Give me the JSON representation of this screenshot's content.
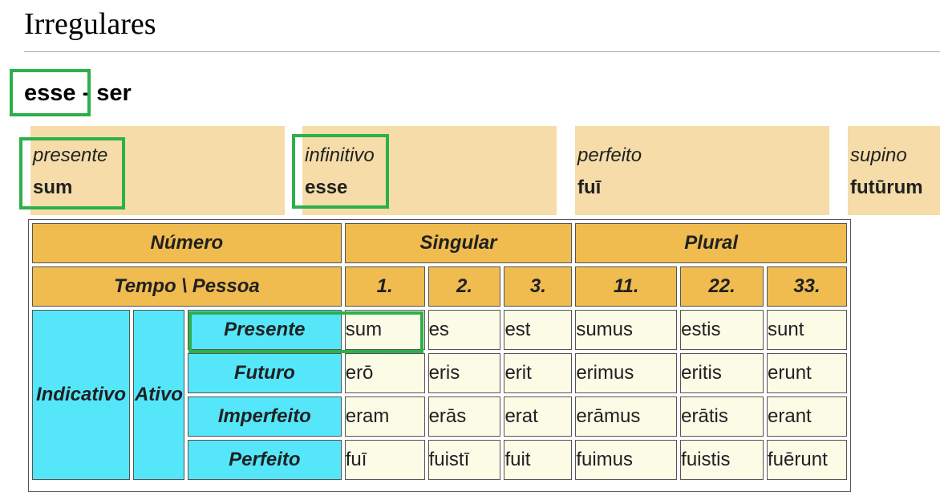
{
  "page": {
    "title": "Irregulares"
  },
  "verb": {
    "infinitive": "esse",
    "separator": " - ",
    "meaning": "ser"
  },
  "principal_parts": [
    {
      "label": "presente",
      "value": "sum"
    },
    {
      "label": "infinitivo",
      "value": "esse"
    },
    {
      "label": "perfeito",
      "value": "fuī"
    },
    {
      "label": "supino",
      "value": "futūrum"
    }
  ],
  "table": {
    "numero_label": "Número",
    "singular_label": "Singular",
    "plural_label": "Plural",
    "tempo_label": "Tempo \\ Pessoa",
    "persons": [
      "1.",
      "2.",
      "3.",
      "11.",
      "22.",
      "33."
    ],
    "mood": "Indicativo",
    "voice": "Ativo",
    "rows": [
      {
        "tense": "Presente",
        "forms": [
          "sum",
          "es",
          "est",
          "sumus",
          "estis",
          "sunt"
        ]
      },
      {
        "tense": "Futuro",
        "forms": [
          "erō",
          "eris",
          "erit",
          "erimus",
          "eritis",
          "erunt"
        ]
      },
      {
        "tense": "Imperfeito",
        "forms": [
          "eram",
          "erās",
          "erat",
          "erāmus",
          "erātis",
          "erant"
        ]
      },
      {
        "tense": "Perfeito",
        "forms": [
          "fuī",
          "fuistī",
          "fuit",
          "fuimus",
          "fuistis",
          "fuērunt"
        ]
      }
    ]
  },
  "colors": {
    "header_orange": "#f0bb4f",
    "principal_part_bg": "#f5dca8",
    "row_header_cyan": "#55e6fa",
    "cell_bg": "#fbfbe6",
    "highlight_green": "#2db04a"
  }
}
